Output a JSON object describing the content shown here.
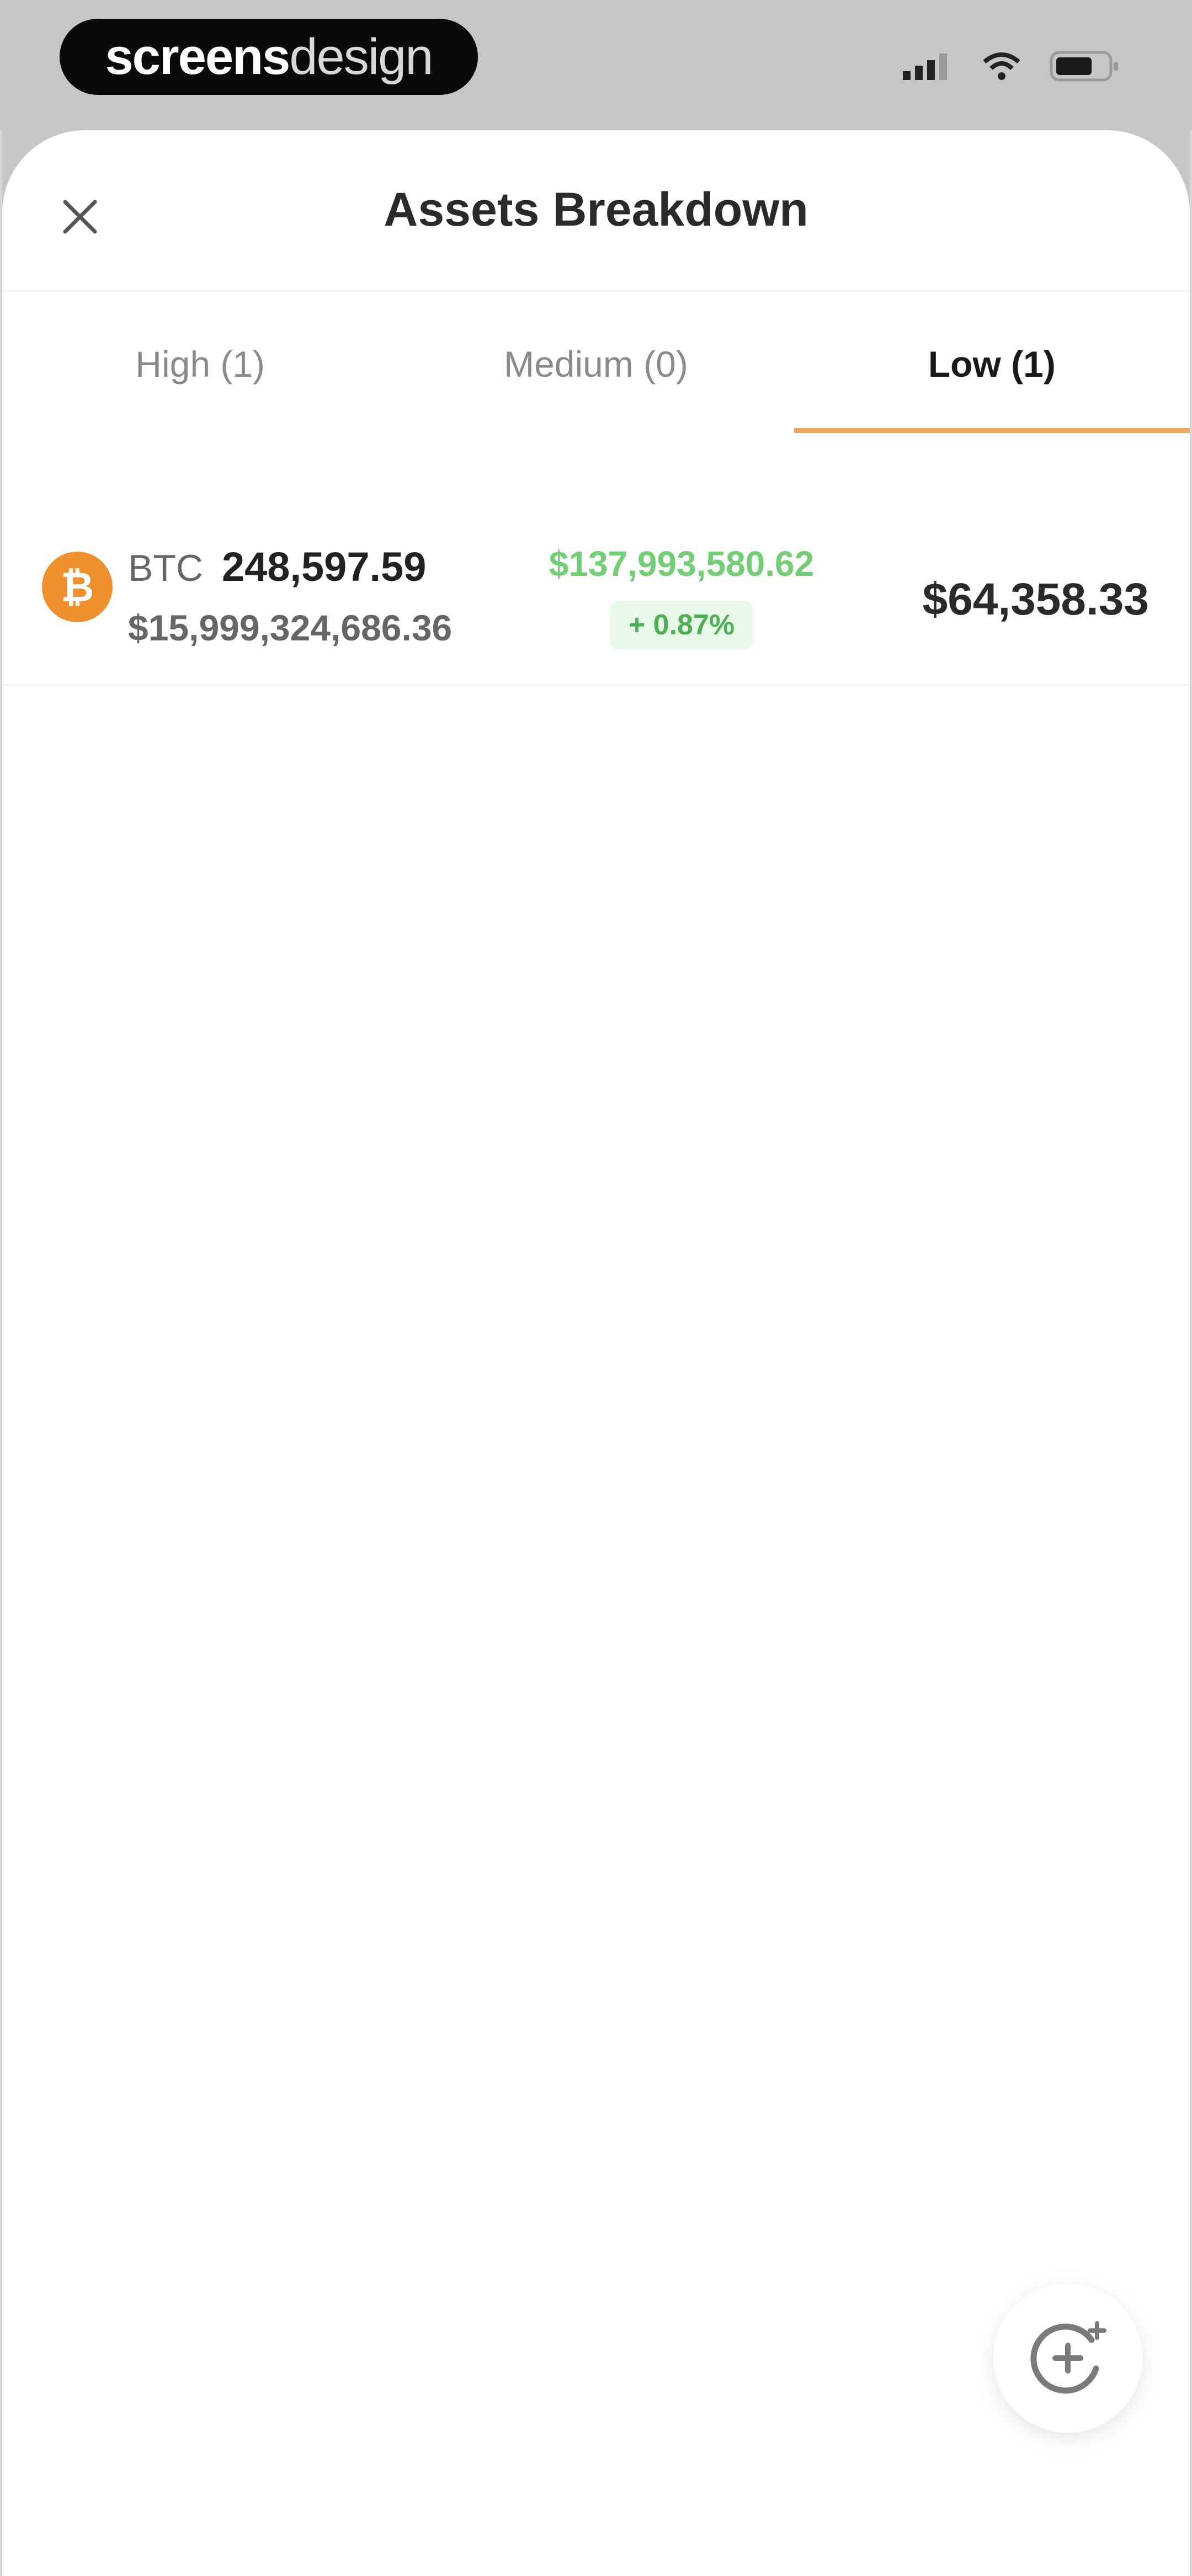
{
  "status_bar": {
    "brand_bold": "screens",
    "brand_light": "design",
    "signal_icon": "signal-icon",
    "wifi_icon": "wifi-icon",
    "battery_icon": "battery-icon"
  },
  "sheet": {
    "title": "Assets Breakdown",
    "close_icon": "close-icon"
  },
  "tabs": [
    {
      "label": "High (1)",
      "active": false
    },
    {
      "label": "Medium (0)",
      "active": false
    },
    {
      "label": "Low (1)",
      "active": true
    }
  ],
  "assets": [
    {
      "icon_glyph": "₿",
      "symbol": "BTC",
      "quantity": "248,597.59",
      "fiat_value": "$15,999,324,686.36",
      "profit": "$137,993,580.62",
      "change": "+ 0.87%",
      "price": "$64,358.33"
    }
  ],
  "fab": {
    "icon": "sparkle-refresh-icon"
  },
  "colors": {
    "accent": "#f0a463",
    "btc": "#f0902c",
    "positive": "#70cf73",
    "positive_bg": "#e8f8e9"
  }
}
